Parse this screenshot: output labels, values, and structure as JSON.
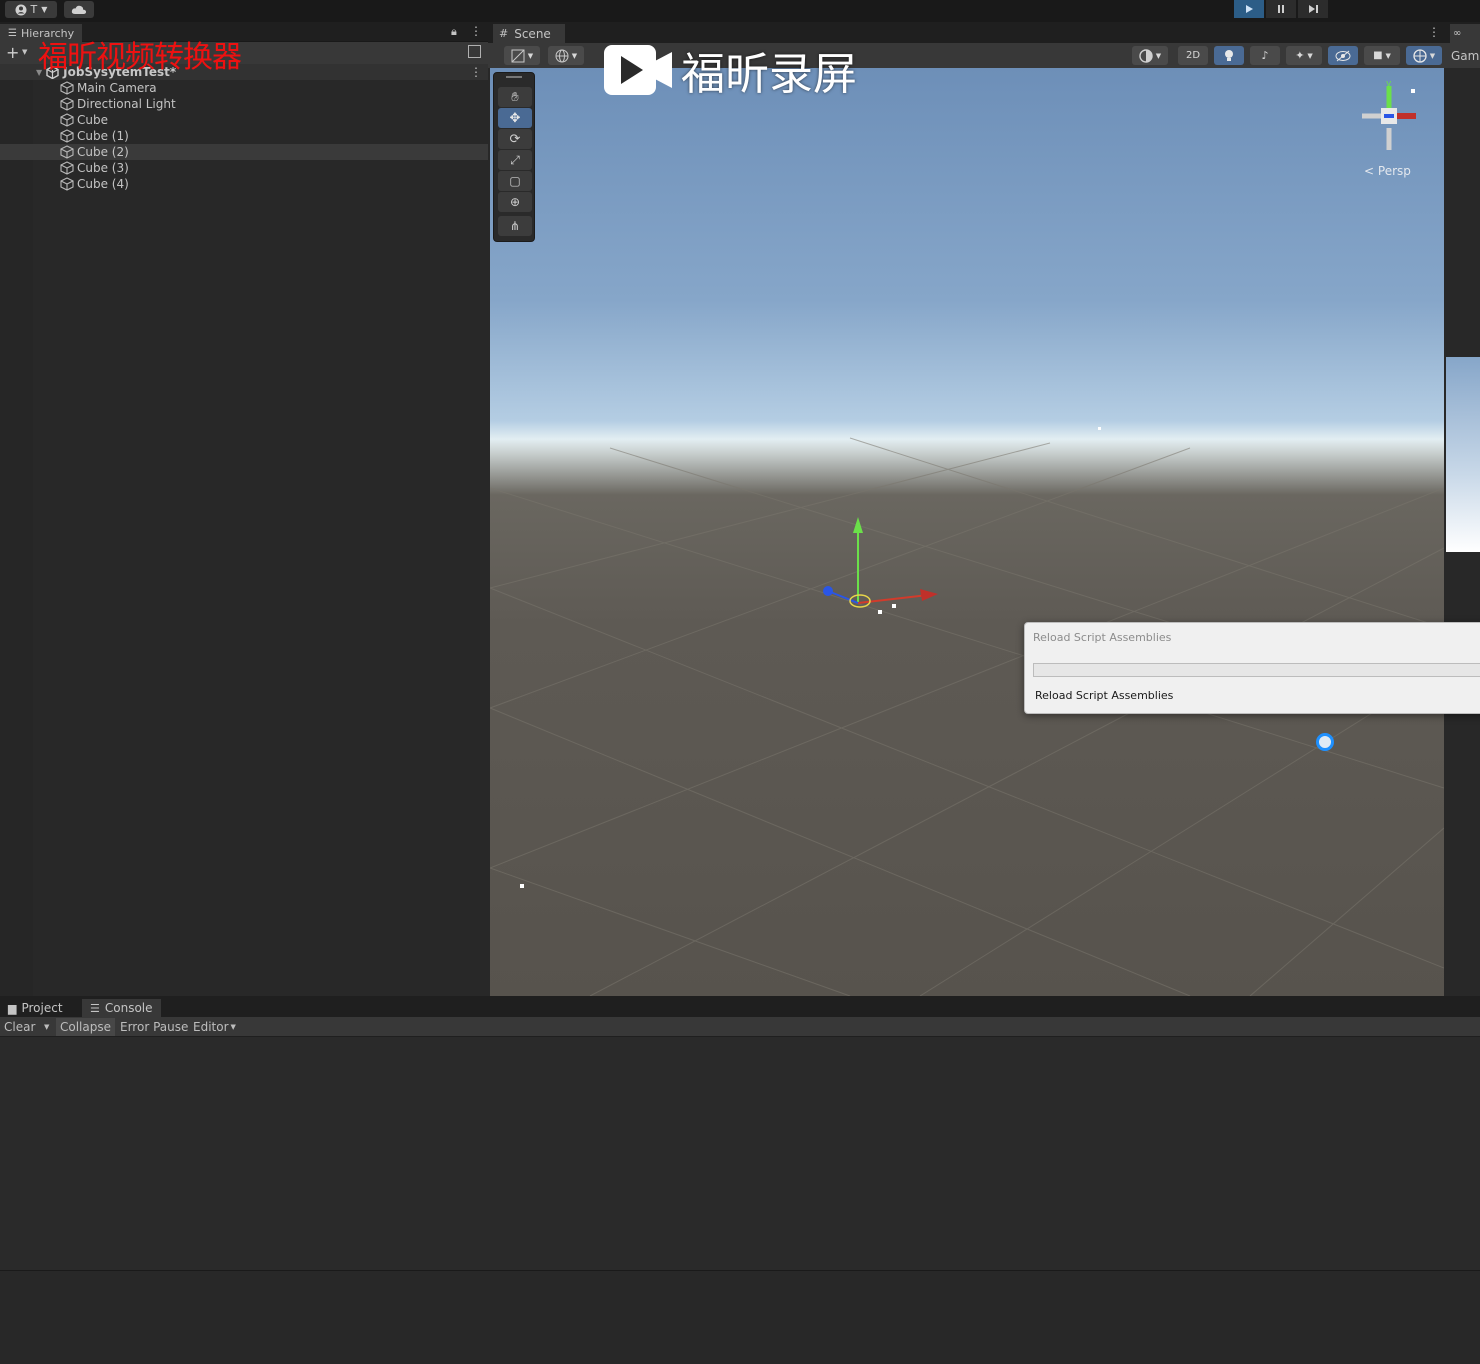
{
  "topbar": {
    "account_label": "T",
    "account_icon": "user-circle-icon",
    "cloud_icon": "cloud-icon",
    "play_icon": "play-icon",
    "pause_icon": "pause-icon",
    "step_icon": "step-icon",
    "accent_color": "#2c5d87"
  },
  "hierarchy": {
    "tab_label": "Hierarchy",
    "scene_name": "JobSysytemTest*",
    "items": [
      {
        "label": "Main Camera"
      },
      {
        "label": "Directional Light"
      },
      {
        "label": "Cube"
      },
      {
        "label": "Cube (1)"
      },
      {
        "label": "Cube (2)",
        "selected": true
      },
      {
        "label": "Cube (3)"
      },
      {
        "label": "Cube (4)"
      }
    ]
  },
  "scene": {
    "tab_label": "Scene",
    "toggle_2d_label": "2D",
    "persp_label": "Persp",
    "gizmo_y_label": "y",
    "tools": [
      "hand-tool-icon",
      "move-tool-icon",
      "rotate-tool-icon",
      "scale-tool-icon",
      "rect-tool-icon",
      "transform-tool-icon",
      "custom-tool-icon"
    ],
    "active_tool": "move-tool-icon"
  },
  "game_tab": {
    "label": "Game"
  },
  "dialog": {
    "title": "Reload Script Assemblies",
    "status": "Reload Script Assemblies",
    "progress": 0.0
  },
  "bottom": {
    "tabs": [
      {
        "label": "Project",
        "icon": "folder-icon"
      },
      {
        "label": "Console",
        "icon": "console-icon"
      }
    ],
    "console_toolbar": {
      "clear_label": "Clear",
      "collapse_label": "Collapse",
      "error_pause_label": "Error Pause",
      "editor_label": "Editor"
    }
  },
  "watermarks": {
    "top_left": "福昕视频转换器",
    "center": "福昕录屏"
  }
}
